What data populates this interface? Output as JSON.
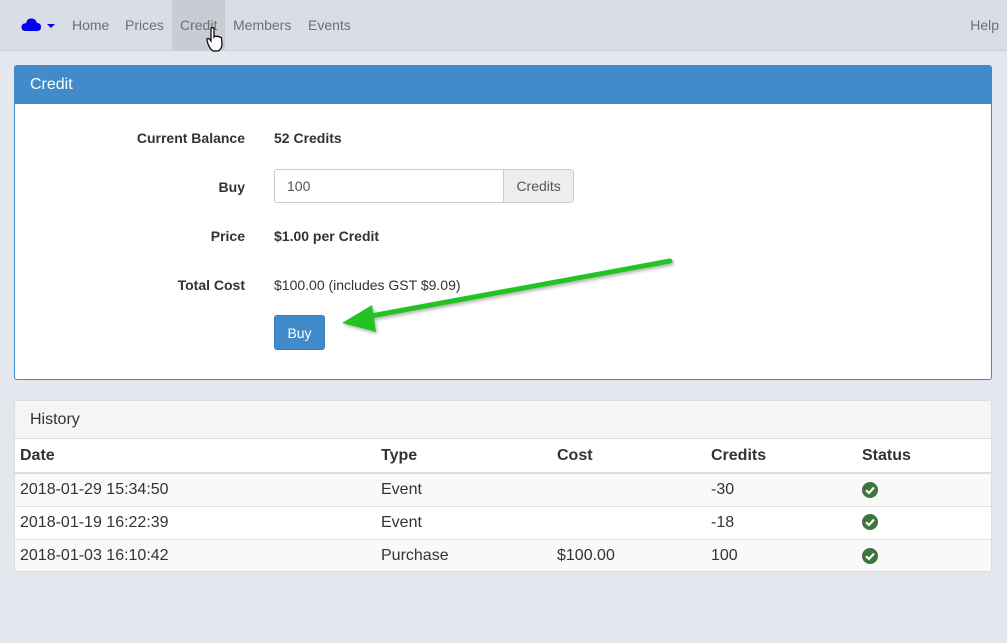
{
  "nav": {
    "items": [
      {
        "label": "Home"
      },
      {
        "label": "Prices"
      },
      {
        "label": "Credit"
      },
      {
        "label": "Members"
      },
      {
        "label": "Events"
      }
    ],
    "help": "Help",
    "brand_icon": "cloud-icon",
    "active": "Credit"
  },
  "credit": {
    "title": "Credit",
    "balance_label": "Current Balance",
    "balance_value": "52 Credits",
    "buy_label": "Buy",
    "buy_value": "100",
    "buy_addon": "Credits",
    "price_label": "Price",
    "price_value": "$1.00 per Credit",
    "total_label": "Total Cost",
    "total_value": "$100.00 (includes GST $9.09)",
    "buy_button": "Buy"
  },
  "history": {
    "title": "History",
    "columns": [
      "Date",
      "Type",
      "Cost",
      "Credits",
      "Status"
    ],
    "rows": [
      {
        "date": "2018-01-29 15:34:50",
        "type": "Event",
        "cost": "",
        "credits": "-30",
        "status": "check-circle-icon"
      },
      {
        "date": "2018-01-19 16:22:39",
        "type": "Event",
        "cost": "",
        "credits": "-18",
        "status": "check-circle-icon"
      },
      {
        "date": "2018-01-03 16:10:42",
        "type": "Purchase",
        "cost": "$100.00",
        "credits": "100",
        "status": "check-circle-icon"
      }
    ]
  },
  "colors": {
    "primary": "#428bca",
    "nav_bg": "#d9dde6",
    "arrow": "#22c322",
    "success": "#3c763d"
  }
}
